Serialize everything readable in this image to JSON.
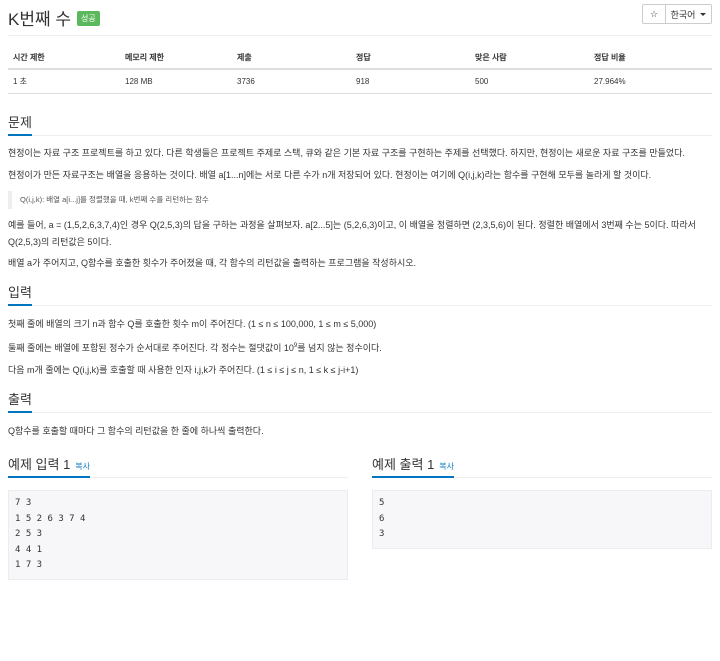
{
  "header": {
    "title": "K번째 수",
    "badge": "성공",
    "star_label": "☆",
    "lang_label": "한국어"
  },
  "info_table": {
    "headers": [
      "시간 제한",
      "메모리 제한",
      "제출",
      "정답",
      "맞은 사람",
      "정답 비율"
    ],
    "values": [
      "1 초",
      "128 MB",
      "3736",
      "918",
      "500",
      "27.964%"
    ]
  },
  "problem": {
    "heading": "문제",
    "p1": "현정이는 자료 구조 프로젝트를 하고 있다. 다른 학생들은 프로젝트 주제로 스택, 큐와 같은 기본 자료 구조를 구현하는 주제를 선택했다. 하지만, 현정이는 새로운 자료 구조를 만들었다.",
    "p2": "현정이가 만든 자료구조는 배열을 응용하는 것이다. 배열 a[1...n]에는 서로 다른 수가 n개 저장되어 있다. 현정이는 여기에 Q(i,j,k)라는 함수를 구현해 모두를 놀라게 할 것이다.",
    "quote": "Q(i,j,k): 배열 a[i...j]를 정렬했을 때, k번째 수를 리턴하는 함수",
    "p3": "예를 들어, a = (1,5,2,6,3,7,4)인 경우 Q(2,5,3)의 답을 구하는 과정을 살펴보자. a[2...5]는 (5,2,6,3)이고, 이 배열을 정렬하면 (2,3,5,6)이 된다. 정렬한 배열에서 3번째 수는 5이다. 따라서 Q(2,5,3)의 리턴값은 5이다.",
    "p4": "배열 a가 주어지고, Q함수를 호출한 횟수가 주어졌을 때, 각 함수의 리턴값을 출력하는 프로그램을 작성하시오."
  },
  "input": {
    "heading": "입력",
    "p1": "첫째 줄에 배열의 크기 n과 함수 Q를 호출한 횟수 m이 주어진다. (1 ≤ n ≤ 100,000, 1 ≤ m ≤ 5,000)",
    "p2_before": "둘째 줄에는 배열에 포함된 정수가 순서대로 주어진다. 각 정수는 절댓값이 10",
    "p2_sup": "9",
    "p2_after": "를 넘지 않는 정수이다.",
    "p3": "다음 m개 줄에는 Q(i,j,k)를 호출할 때 사용한 인자 i,j,k가 주어진다. (1 ≤ i ≤ j ≤ n, 1 ≤ k ≤ j-i+1)"
  },
  "output": {
    "heading": "출력",
    "p1": "Q함수를 호출할 때마다 그 함수의 리턴값을 한 줄에 하나씩 출력한다."
  },
  "sample_input": {
    "heading": "예제 입력 1",
    "copy": "복사",
    "text": "7 3\n1 5 2 6 3 7 4\n2 5 3\n4 4 1\n1 7 3"
  },
  "sample_output": {
    "heading": "예제 출력 1",
    "copy": "복사",
    "text": "5\n6\n3"
  }
}
